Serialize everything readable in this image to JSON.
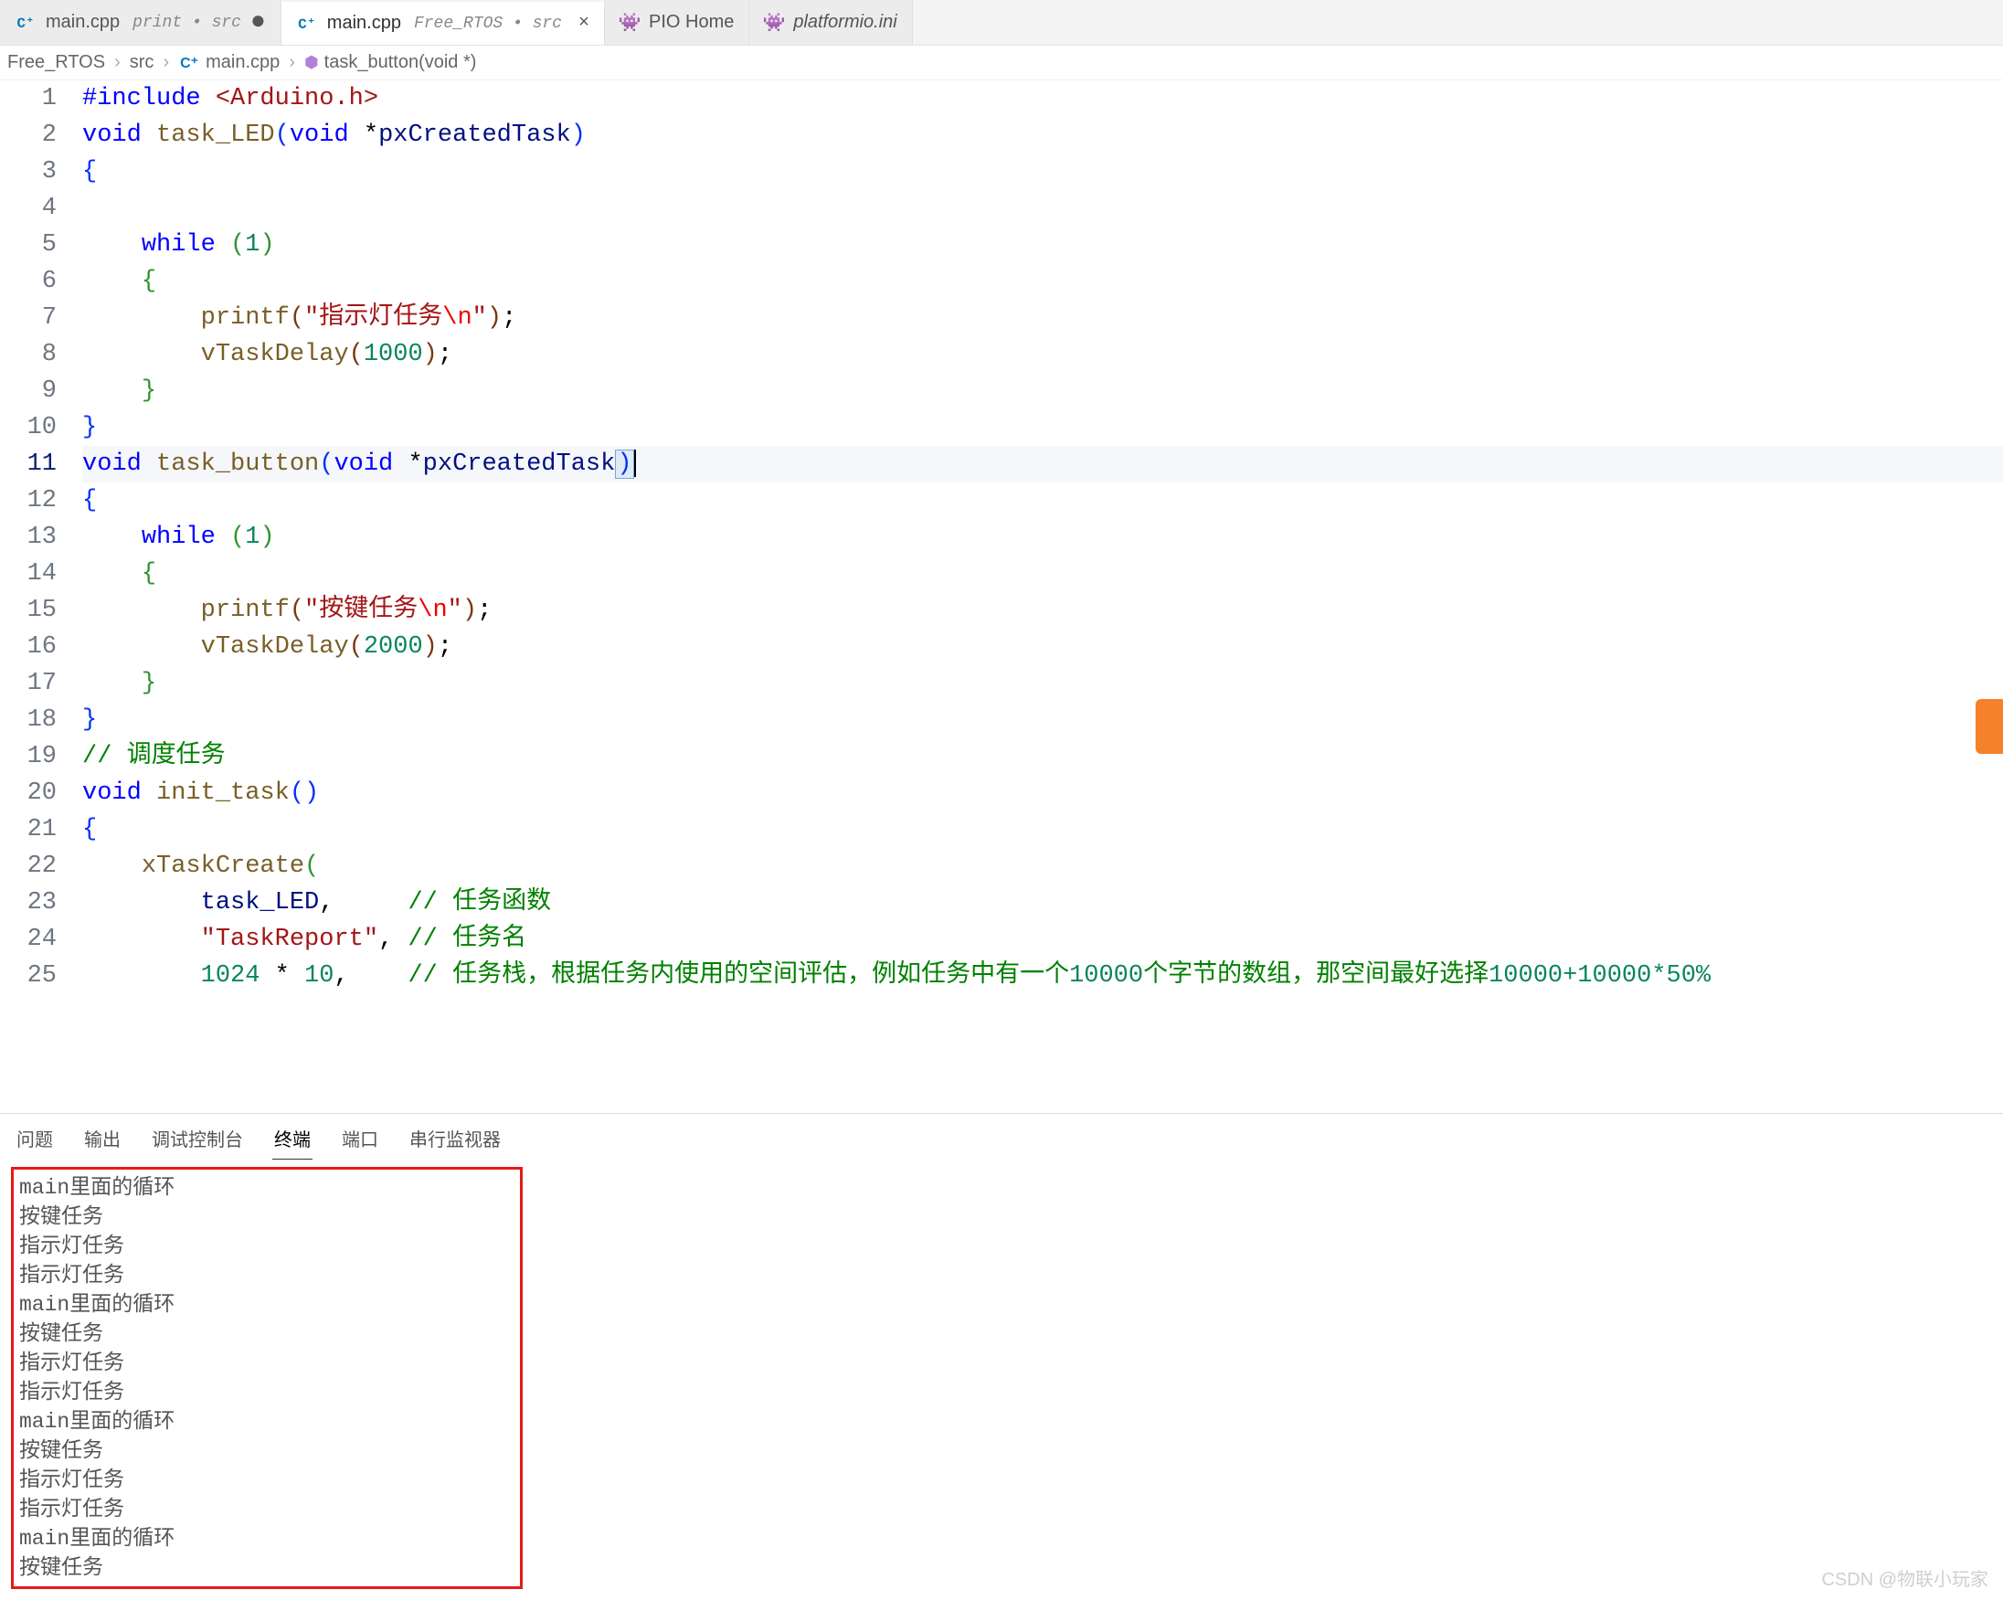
{
  "tabs": [
    {
      "icon": "cpp",
      "title": "main.cpp",
      "sub": "print • src",
      "active": false,
      "close": false,
      "dirty": false
    },
    {
      "icon": "cpp",
      "title": "main.cpp",
      "sub": "Free_RTOS • src",
      "active": true,
      "close": true,
      "dirty": true
    },
    {
      "icon": "pio",
      "title": "PIO Home",
      "sub": "",
      "active": false,
      "close": false,
      "dirty": false
    },
    {
      "icon": "pio",
      "title": "platformio.ini",
      "sub": "",
      "active": false,
      "close": false,
      "dirty": false,
      "italic": true
    }
  ],
  "breadcrumb": {
    "parts": [
      "Free_RTOS",
      "src",
      "main.cpp",
      "task_button(void *)"
    ],
    "file_icon": "cpp",
    "sym_icon": "cube"
  },
  "code": {
    "lines": [
      {
        "n": 1,
        "seg": [
          [
            "kw",
            "#include"
          ],
          [
            "op",
            " "
          ],
          [
            "str",
            "<Arduino.h>"
          ]
        ]
      },
      {
        "n": 2,
        "seg": [
          [
            "kw",
            "void"
          ],
          [
            "op",
            " "
          ],
          [
            "fn",
            "task_LED"
          ],
          [
            "brace",
            "("
          ],
          [
            "kw",
            "void"
          ],
          [
            "op",
            " *"
          ],
          [
            "pn",
            "pxCreatedTask"
          ],
          [
            "brace",
            ")"
          ]
        ]
      },
      {
        "n": 3,
        "seg": [
          [
            "brace",
            "{"
          ]
        ]
      },
      {
        "n": 4,
        "seg": [
          [
            "op",
            ""
          ]
        ]
      },
      {
        "n": 5,
        "seg": [
          [
            "op",
            "    "
          ],
          [
            "kw",
            "while"
          ],
          [
            "op",
            " "
          ],
          [
            "brace2",
            "("
          ],
          [
            "num",
            "1"
          ],
          [
            "brace2",
            ")"
          ]
        ]
      },
      {
        "n": 6,
        "seg": [
          [
            "op",
            "    "
          ],
          [
            "brace2",
            "{"
          ]
        ]
      },
      {
        "n": 7,
        "seg": [
          [
            "op",
            "        "
          ],
          [
            "fn",
            "printf"
          ],
          [
            "brace3",
            "("
          ],
          [
            "str",
            "\"指示灯任务"
          ],
          [
            "esc",
            "\\n"
          ],
          [
            "str",
            "\""
          ],
          [
            "brace3",
            ")"
          ],
          [
            "op",
            ";"
          ]
        ]
      },
      {
        "n": 8,
        "seg": [
          [
            "op",
            "        "
          ],
          [
            "fn",
            "vTaskDelay"
          ],
          [
            "brace3",
            "("
          ],
          [
            "num",
            "1000"
          ],
          [
            "brace3",
            ")"
          ],
          [
            "op",
            ";"
          ]
        ]
      },
      {
        "n": 9,
        "seg": [
          [
            "op",
            "    "
          ],
          [
            "brace2",
            "}"
          ]
        ]
      },
      {
        "n": 10,
        "seg": [
          [
            "brace",
            "}"
          ]
        ]
      },
      {
        "n": 11,
        "hl": true,
        "seg": [
          [
            "kw",
            "void"
          ],
          [
            "op",
            " "
          ],
          [
            "fn",
            "task_button"
          ],
          [
            "brace",
            "("
          ],
          [
            "kw",
            "void"
          ],
          [
            "op",
            " *"
          ],
          [
            "pn",
            "pxCreatedTask"
          ],
          [
            "cursorbox",
            ")"
          ]
        ]
      },
      {
        "n": 12,
        "seg": [
          [
            "brace",
            "{"
          ]
        ]
      },
      {
        "n": 13,
        "seg": [
          [
            "op",
            "    "
          ],
          [
            "kw",
            "while"
          ],
          [
            "op",
            " "
          ],
          [
            "brace2",
            "("
          ],
          [
            "num",
            "1"
          ],
          [
            "brace2",
            ")"
          ]
        ]
      },
      {
        "n": 14,
        "seg": [
          [
            "op",
            "    "
          ],
          [
            "brace2",
            "{"
          ]
        ]
      },
      {
        "n": 15,
        "seg": [
          [
            "op",
            "        "
          ],
          [
            "fn",
            "printf"
          ],
          [
            "brace3",
            "("
          ],
          [
            "str",
            "\"按键任务"
          ],
          [
            "esc",
            "\\n"
          ],
          [
            "str",
            "\""
          ],
          [
            "brace3",
            ")"
          ],
          [
            "op",
            ";"
          ]
        ]
      },
      {
        "n": 16,
        "seg": [
          [
            "op",
            "        "
          ],
          [
            "fn",
            "vTaskDelay"
          ],
          [
            "brace3",
            "("
          ],
          [
            "num",
            "2000"
          ],
          [
            "brace3",
            ")"
          ],
          [
            "op",
            ";"
          ]
        ]
      },
      {
        "n": 17,
        "seg": [
          [
            "op",
            "    "
          ],
          [
            "brace2",
            "}"
          ]
        ]
      },
      {
        "n": 18,
        "seg": [
          [
            "brace",
            "}"
          ]
        ]
      },
      {
        "n": 19,
        "seg": [
          [
            "cm",
            "// 调度任务"
          ]
        ]
      },
      {
        "n": 20,
        "seg": [
          [
            "kw",
            "void"
          ],
          [
            "op",
            " "
          ],
          [
            "fn",
            "init_task"
          ],
          [
            "brace",
            "()"
          ]
        ]
      },
      {
        "n": 21,
        "seg": [
          [
            "brace",
            "{"
          ]
        ]
      },
      {
        "n": 22,
        "seg": [
          [
            "op",
            "    "
          ],
          [
            "fn",
            "xTaskCreate"
          ],
          [
            "brace2",
            "("
          ]
        ]
      },
      {
        "n": 23,
        "seg": [
          [
            "op",
            "        "
          ],
          [
            "pn",
            "task_LED"
          ],
          [
            "op",
            ",     "
          ],
          [
            "cm",
            "// 任务函数"
          ]
        ]
      },
      {
        "n": 24,
        "seg": [
          [
            "op",
            "        "
          ],
          [
            "str",
            "\"TaskReport\""
          ],
          [
            "op",
            ", "
          ],
          [
            "cm",
            "// 任务名"
          ]
        ]
      },
      {
        "n": 25,
        "seg": [
          [
            "op",
            "        "
          ],
          [
            "num",
            "1024"
          ],
          [
            "op",
            " * "
          ],
          [
            "num",
            "10"
          ],
          [
            "op",
            ",    "
          ],
          [
            "cm",
            "// 任务栈，根据任务内使用的空间评估，例如任务中有一个"
          ],
          [
            "num2",
            "10000"
          ],
          [
            "cm",
            "个字节的数组，那空间最好选择"
          ],
          [
            "num2",
            "10000+10000*50%"
          ]
        ]
      }
    ]
  },
  "panel": {
    "tabs": [
      "问题",
      "输出",
      "调试控制台",
      "终端",
      "端口",
      "串行监视器"
    ],
    "active": "终端",
    "output": [
      "main里面的循环",
      "按键任务",
      "指示灯任务",
      "指示灯任务",
      "main里面的循环",
      "按键任务",
      "指示灯任务",
      "指示灯任务",
      "main里面的循环",
      "按键任务",
      "指示灯任务",
      "指示灯任务",
      "main里面的循环",
      "按键任务"
    ]
  },
  "watermark": "CSDN @物联小玩家",
  "icons": {
    "cpp": "C⁺",
    "pio": "👾",
    "cube": "⬢",
    "close": "×",
    "dot": "●",
    "sep": "›"
  }
}
